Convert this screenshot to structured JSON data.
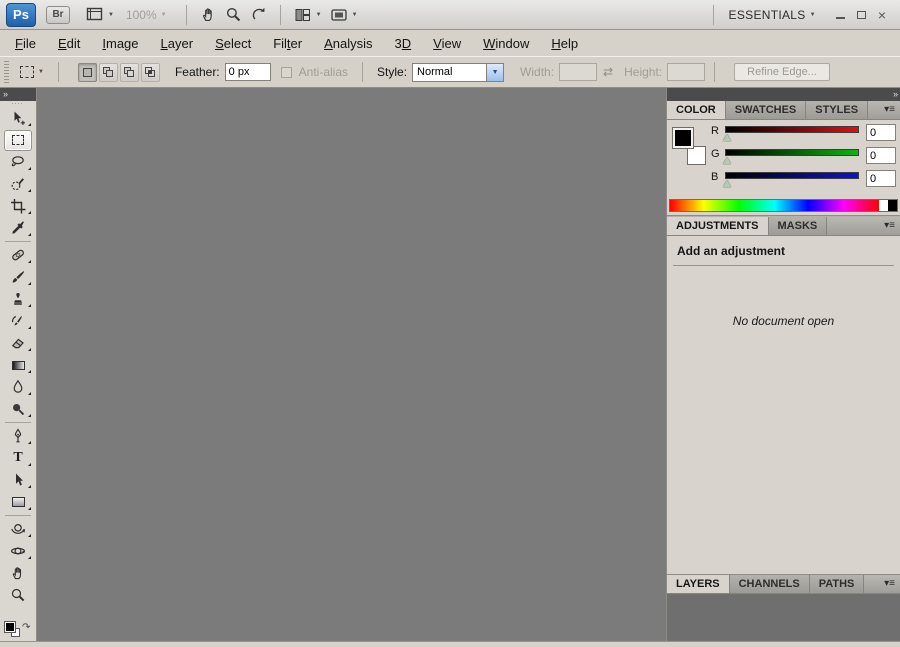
{
  "app_bar": {
    "ps_logo": "Ps",
    "bridge_label": "Br",
    "zoom_level": "100%",
    "workspace_label": "ESSENTIALS",
    "close_glyph": "×",
    "icons": [
      "view-extras",
      "hand",
      "zoom",
      "rotate-view",
      "arrange-documents",
      "screen-mode"
    ]
  },
  "menu_bar": {
    "items": [
      {
        "pre": "",
        "key": "F",
        "post": "ile"
      },
      {
        "pre": "",
        "key": "E",
        "post": "dit"
      },
      {
        "pre": "",
        "key": "I",
        "post": "mage"
      },
      {
        "pre": "",
        "key": "L",
        "post": "ayer"
      },
      {
        "pre": "",
        "key": "S",
        "post": "elect"
      },
      {
        "pre": "Fil",
        "key": "t",
        "post": "er"
      },
      {
        "pre": "",
        "key": "A",
        "post": "nalysis"
      },
      {
        "pre": "3",
        "key": "D",
        "post": ""
      },
      {
        "pre": "",
        "key": "V",
        "post": "iew"
      },
      {
        "pre": "",
        "key": "W",
        "post": "indow"
      },
      {
        "pre": "",
        "key": "H",
        "post": "elp"
      }
    ]
  },
  "options_bar": {
    "tool_preset": "rectangular-marquee",
    "selection_modes": [
      "new-selection",
      "add-to-selection",
      "subtract-from-selection",
      "intersect-selection"
    ],
    "feather_label": "Feather:",
    "feather_value": "0 px",
    "antialias_label": "Anti-alias",
    "style_label": "Style:",
    "style_value": "Normal",
    "width_label": "Width:",
    "width_value": "",
    "height_label": "Height:",
    "height_value": "",
    "refine_edge_label": "Refine Edge..."
  },
  "tools": [
    "move",
    "rectangular-marquee",
    "lasso",
    "quick-selection",
    "crop",
    "eyedropper",
    "spot-healing-brush",
    "brush",
    "clone-stamp",
    "history-brush",
    "eraser",
    "gradient",
    "blur",
    "dodge",
    "pen",
    "type",
    "path-selection",
    "rectangle-shape",
    "3d-rotate",
    "3d-orbit",
    "hand",
    "zoom"
  ],
  "selected_tool": "rectangular-marquee",
  "color_panel": {
    "tabs": [
      "COLOR",
      "SWATCHES",
      "STYLES"
    ],
    "channels": [
      {
        "label": "R",
        "value": "0"
      },
      {
        "label": "G",
        "value": "0"
      },
      {
        "label": "B",
        "value": "0"
      }
    ],
    "foreground": "#000000",
    "background": "#ffffff"
  },
  "adjustments_panel": {
    "tabs": [
      "ADJUSTMENTS",
      "MASKS"
    ],
    "heading": "Add an adjustment",
    "empty_message": "No document open"
  },
  "layers_panel": {
    "tabs": [
      "LAYERS",
      "CHANNELS",
      "PATHS"
    ]
  },
  "colors": {
    "chrome": "#d6d2ca",
    "canvas": "#7b7b7b",
    "accent_blue": "#2d72b8",
    "dock_header": "#4b4b4b",
    "layers_content": "#6f6f6f"
  },
  "icons": {
    "collapse": "»",
    "dropdown": "▼",
    "panel_menu": "▾≡",
    "swap_dims": "⇄",
    "swap_colors": "↷",
    "type_glyph": "T"
  }
}
